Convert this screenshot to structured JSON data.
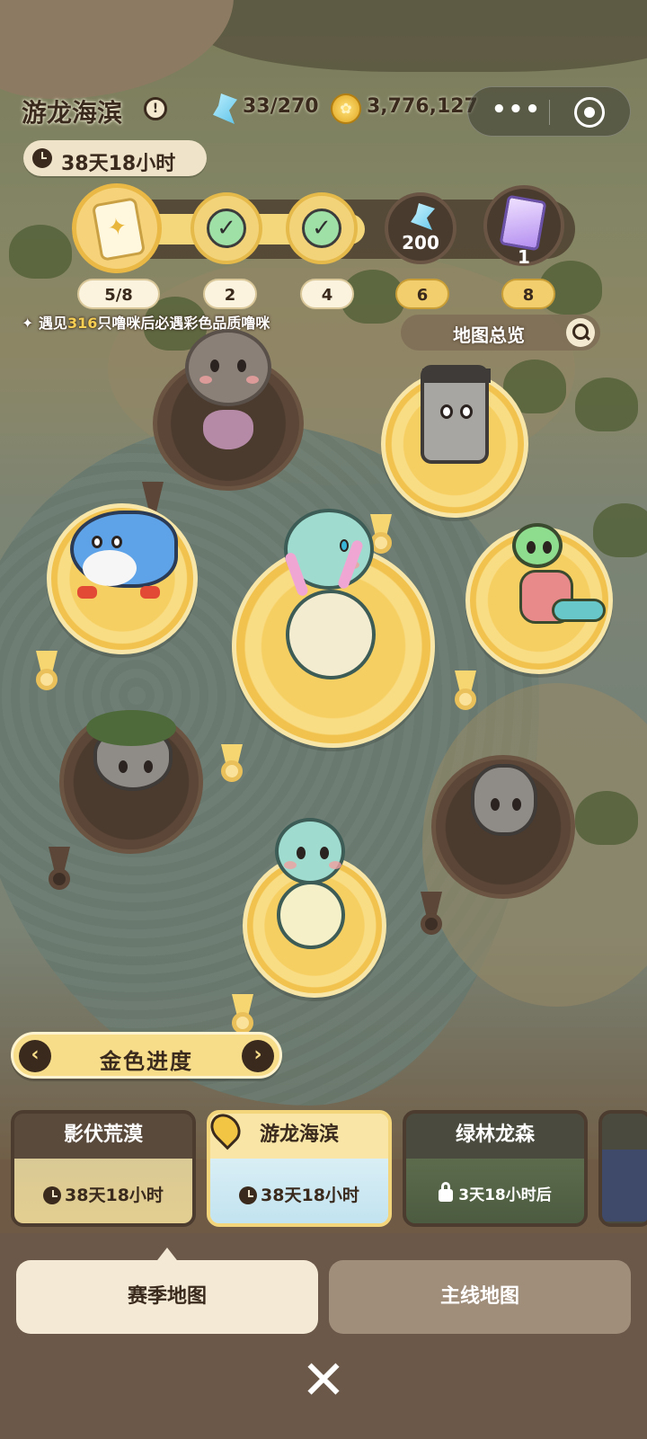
{
  "header": {
    "title": "游龙海滨",
    "info_icon": "info-icon",
    "gems": "33/270",
    "coins": "3,776,127",
    "menu_dots": "•••",
    "season_timer": "38天18小时"
  },
  "progress": {
    "nodes": [
      {
        "icon": "card-icon",
        "label": "5/8",
        "state": "current"
      },
      {
        "icon": "check-icon",
        "label": "2",
        "state": "done"
      },
      {
        "icon": "check-icon",
        "label": "4",
        "state": "done"
      },
      {
        "icon": "gem-icon",
        "reward": "200",
        "label": "6",
        "state": "locked"
      },
      {
        "icon": "purple-card-icon",
        "reward": "1",
        "label": "8",
        "state": "locked"
      }
    ],
    "check_mark": "✓",
    "hint_prefix": "遇见",
    "hint_count": "316",
    "hint_suffix": "只噜咪后必遇彩色品质噜咪"
  },
  "overview_button": "地图总览",
  "golden_progress": {
    "label": "金色进度",
    "prev": "‹",
    "next": "›"
  },
  "map_cards": [
    {
      "title": "影伏荒漠",
      "timer": "38天18小时",
      "state": "normal"
    },
    {
      "title": "游龙海滨",
      "timer": "38天18小时",
      "state": "active"
    },
    {
      "title": "绿林龙森",
      "timer": "3天18小时后",
      "state": "locked"
    }
  ],
  "tabs": {
    "season": "赛季地图",
    "main": "主线地图"
  },
  "close": "✕",
  "colors": {
    "gold": "#f6cf62",
    "dark_pin": "#4b3a2e",
    "accent_yellow": "#f7cf53"
  }
}
